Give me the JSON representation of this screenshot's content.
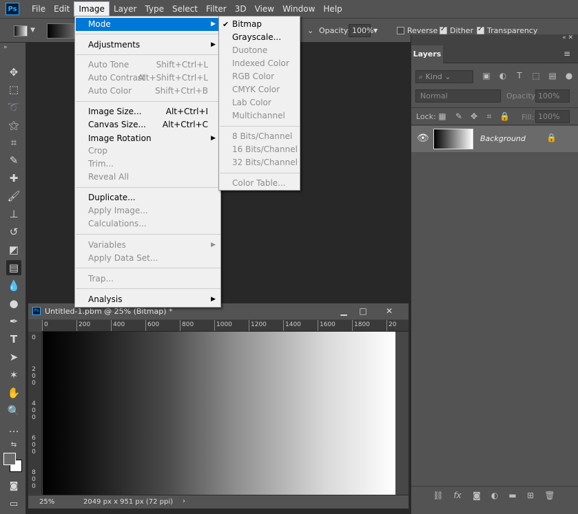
{
  "menubar": {
    "logo": "Ps",
    "items": [
      "File",
      "Edit",
      "Image",
      "Layer",
      "Type",
      "Select",
      "Filter",
      "3D",
      "View",
      "Window",
      "Help"
    ],
    "active": "Image"
  },
  "options": {
    "opacity_label": "Opacity:",
    "opacity_value": "100%",
    "reverse_label": "Reverse",
    "dither_label": "Dither",
    "transparency_label": "Transparency",
    "reverse_checked": false,
    "dither_checked": true,
    "transparency_checked": true
  },
  "image_menu": {
    "items": [
      {
        "label": "Mode",
        "shortcut": "",
        "submenu": true,
        "disabled": false,
        "highlighted": true
      },
      {
        "label": "Adjustments",
        "shortcut": "",
        "submenu": true,
        "disabled": false
      },
      {
        "label": "Auto Tone",
        "shortcut": "Shift+Ctrl+L",
        "disabled": true
      },
      {
        "label": "Auto Contrast",
        "shortcut": "Alt+Shift+Ctrl+L",
        "disabled": true
      },
      {
        "label": "Auto Color",
        "shortcut": "Shift+Ctrl+B",
        "disabled": true
      },
      {
        "label": "Image Size...",
        "shortcut": "Alt+Ctrl+I",
        "disabled": false
      },
      {
        "label": "Canvas Size...",
        "shortcut": "Alt+Ctrl+C",
        "disabled": false
      },
      {
        "label": "Image Rotation",
        "shortcut": "",
        "submenu": true,
        "disabled": false
      },
      {
        "label": "Crop",
        "shortcut": "",
        "disabled": true
      },
      {
        "label": "Trim...",
        "shortcut": "",
        "disabled": true
      },
      {
        "label": "Reveal All",
        "shortcut": "",
        "disabled": true
      },
      {
        "label": "Duplicate...",
        "shortcut": "",
        "disabled": false
      },
      {
        "label": "Apply Image...",
        "shortcut": "",
        "disabled": true
      },
      {
        "label": "Calculations...",
        "shortcut": "",
        "disabled": true
      },
      {
        "label": "Variables",
        "shortcut": "",
        "submenu": true,
        "disabled": true
      },
      {
        "label": "Apply Data Set...",
        "shortcut": "",
        "disabled": true
      },
      {
        "label": "Trap...",
        "shortcut": "",
        "disabled": true
      },
      {
        "label": "Analysis",
        "shortcut": "",
        "submenu": true,
        "disabled": false
      }
    ]
  },
  "mode_submenu": {
    "items": [
      {
        "label": "Bitmap",
        "checked": true,
        "disabled": false
      },
      {
        "label": "Grayscale...",
        "checked": false,
        "disabled": false
      },
      {
        "label": "Duotone",
        "checked": false,
        "disabled": true
      },
      {
        "label": "Indexed Color",
        "checked": false,
        "disabled": true
      },
      {
        "label": "RGB Color",
        "checked": false,
        "disabled": true
      },
      {
        "label": "CMYK Color",
        "checked": false,
        "disabled": true
      },
      {
        "label": "Lab Color",
        "checked": false,
        "disabled": true
      },
      {
        "label": "Multichannel",
        "checked": false,
        "disabled": true
      },
      {
        "label": "8 Bits/Channel",
        "checked": false,
        "disabled": true
      },
      {
        "label": "16 Bits/Channel",
        "checked": false,
        "disabled": true
      },
      {
        "label": "32 Bits/Channel",
        "checked": false,
        "disabled": true
      },
      {
        "label": "Color Table...",
        "checked": false,
        "disabled": true
      }
    ]
  },
  "document": {
    "title": "Untitled-1.pbm @ 25% (Bitmap) *",
    "zoom": "25%",
    "size_info": "2049 px x 951 px (72 ppi)",
    "ruler_h": [
      "0",
      "200",
      "400",
      "600",
      "800",
      "1000",
      "1200",
      "1400",
      "1600",
      "1800",
      "20"
    ],
    "ruler_v": [
      "0",
      "200",
      "400",
      "600",
      "800"
    ]
  },
  "layers_panel": {
    "tab": "Layers",
    "kind_filter": "Kind",
    "blend_mode": "Normal",
    "opacity_label": "Opacity:",
    "opacity_value": "100%",
    "lock_label": "Lock:",
    "fill_label": "Fill:",
    "fill_value": "100%",
    "layer_name": "Background"
  },
  "colors": {
    "highlight": "#0078d7",
    "ps_blue": "#31a8ff",
    "panel_bg": "#535353",
    "workspace_bg": "#282828"
  }
}
